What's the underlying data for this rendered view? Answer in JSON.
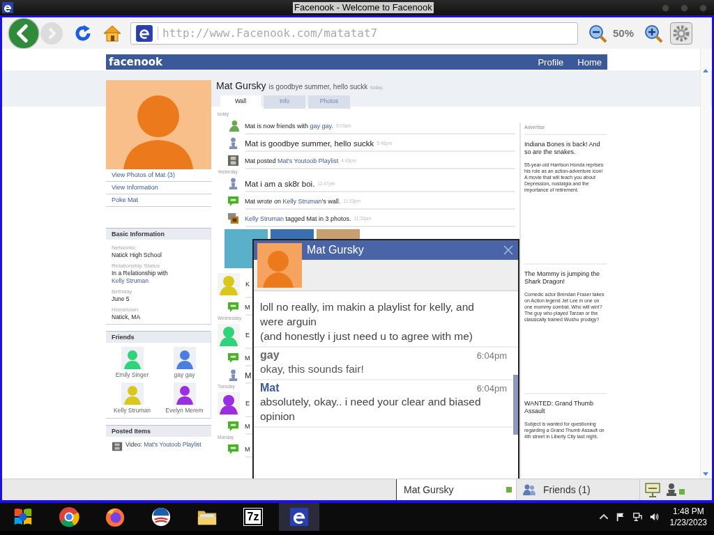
{
  "window": {
    "title": "Facenook - Welcome to Facenook"
  },
  "toolbar": {
    "url": "http://www.Facenook.com/matatat7",
    "zoom": "50%"
  },
  "site": {
    "logo": "facenook",
    "nav": [
      "Profile",
      "Home"
    ]
  },
  "profile": {
    "name": "Mat Gursky",
    "status": "is goodbye summer, hello suckk",
    "status_time": "today.",
    "links": [
      "View Photos of Mat (3)",
      "View Information",
      "Poke Mat"
    ],
    "tabs": [
      {
        "label": "Wall",
        "selected": true
      },
      {
        "label": "Info",
        "selected": false
      },
      {
        "label": "Photos",
        "selected": false
      }
    ]
  },
  "basic_info": {
    "title": "Basic Information",
    "fields": [
      {
        "label": "Networks:",
        "value": "Natick High School"
      },
      {
        "label": "Relationship Status",
        "value": "In a Relationship with",
        "link": "Kelly Struman"
      },
      {
        "label": "Birthday",
        "value": "June 5"
      },
      {
        "label": "Hometown",
        "value": "Natick, MA"
      }
    ]
  },
  "friends": {
    "title": "Friends",
    "items": [
      {
        "name": "Emily Singer",
        "color": "#2fd37a"
      },
      {
        "name": "gay gay",
        "color": "#4a7fe0"
      },
      {
        "name": "Kelly Struman",
        "color": "#d8c81c"
      },
      {
        "name": "Evelyn Merem",
        "color": "#9a2ee0"
      }
    ]
  },
  "posted_items": {
    "title": "Posted Items",
    "items": [
      {
        "prefix": "Video: ",
        "link": "Mat's Youtoob Playlist"
      }
    ]
  },
  "feed": [
    {
      "kind": "day",
      "text": "today"
    },
    {
      "kind": "friend",
      "segments": [
        {
          "text": "Mat is now friends with ",
          "link": false
        },
        {
          "text": "gay gay",
          "link": true
        },
        {
          "text": ".",
          "link": false
        }
      ],
      "time": "5:03am"
    },
    {
      "kind": "status",
      "segments": [
        {
          "text": "Mat is goodbye summer, hello suckk",
          "link": false
        }
      ],
      "time": "5:46pm"
    },
    {
      "kind": "video",
      "segments": [
        {
          "text": "Mat posted ",
          "link": false
        },
        {
          "text": "Mat's Youtoob Playlist",
          "link": true
        }
      ],
      "time": "4:43pm"
    },
    {
      "kind": "day",
      "text": "Yesterday"
    },
    {
      "kind": "status",
      "segments": [
        {
          "text": "Mat i am a sk8r boi.",
          "link": false
        }
      ],
      "time": "11:47pm"
    },
    {
      "kind": "wall",
      "segments": [
        {
          "text": "Mat wrote on ",
          "link": false
        },
        {
          "text": "Kelly Struman",
          "link": true
        },
        {
          "text": "'s wall.",
          "link": false
        }
      ],
      "time": "11:33pm"
    },
    {
      "kind": "tag",
      "segments": [
        {
          "text": "Kelly Struman",
          "link": true
        },
        {
          "text": " tagged Mat in 3 photos.",
          "link": false
        }
      ],
      "time": "11:33pm"
    },
    {
      "kind": "photos"
    },
    {
      "kind": "post",
      "color": "#d8c81c",
      "segments": [
        {
          "text": "K",
          "link": false
        }
      ]
    },
    {
      "kind": "wall",
      "segments": [
        {
          "text": "M",
          "link": false
        }
      ]
    },
    {
      "kind": "day",
      "text": "Wednesday"
    },
    {
      "kind": "post",
      "color": "#2fd37a",
      "segments": [
        {
          "text": "E",
          "link": false
        }
      ]
    },
    {
      "kind": "wall",
      "segments": [
        {
          "text": "M",
          "link": false
        }
      ]
    },
    {
      "kind": "status",
      "segments": [
        {
          "text": "M",
          "link": false
        }
      ]
    },
    {
      "kind": "day",
      "text": "Tuesday"
    },
    {
      "kind": "post",
      "color": "#9a2ee0",
      "segments": [
        {
          "text": "E",
          "link": false
        }
      ]
    },
    {
      "kind": "wall",
      "segments": [
        {
          "text": "M",
          "link": false
        }
      ]
    },
    {
      "kind": "day",
      "text": "Monday"
    },
    {
      "kind": "wall",
      "segments": [
        {
          "text": "M",
          "link": false
        }
      ]
    }
  ],
  "ads": {
    "title": "Advertise",
    "items": [
      {
        "headline": "Indiana Bones is back! And so are the snakes.",
        "body": "55-year-old Harrison Honda reprises his role as an action-adventure icon! A movie that will teach you about Depression, nostalgia and the importance of retirement."
      },
      {
        "headline": "The Mommy is jumping the Shark Dragon!",
        "body": "Comedic actor Brendan Fraser takes on Action legend Jet Lee in one on one mommy combat. Who will win!? The guy who played Tarzan or the classically trained Wushu prodigy?"
      },
      {
        "headline": "WANTED: Grand Thumb Assault",
        "body": "Subject is wanted for questioning regarding a Grand Thumb Assault on 4th street in Liberty City last night."
      }
    ]
  },
  "chat": {
    "name": "Mat Gursky",
    "messages": [
      {
        "kind": "self",
        "text": "loll no really, im makin a playlist for kelly, and were arguin\n(and honestly i just need u to agree with me)"
      },
      {
        "kind": "other",
        "author": "gay",
        "time": "6:04pm",
        "text": "okay, this sounds fair!"
      },
      {
        "kind": "self",
        "author": "Mat",
        "time": "6:04pm",
        "text": "absolutely, okay.. i need your clear and biased opinion"
      }
    ]
  },
  "chat_bar": {
    "tab": "Mat Gursky",
    "online": true,
    "friends": "Friends (1)"
  },
  "taskbar": {
    "apps": [
      {
        "kind": "start",
        "selected": false
      },
      {
        "kind": "chrome",
        "selected": false
      },
      {
        "kind": "firefox",
        "selected": false
      },
      {
        "kind": "campaign",
        "selected": false
      },
      {
        "kind": "folder",
        "selected": false
      },
      {
        "kind": "archive",
        "label": "7z",
        "selected": false
      },
      {
        "kind": "browser",
        "selected": true
      }
    ],
    "time": "1:48 PM",
    "date": "1/23/2023"
  }
}
